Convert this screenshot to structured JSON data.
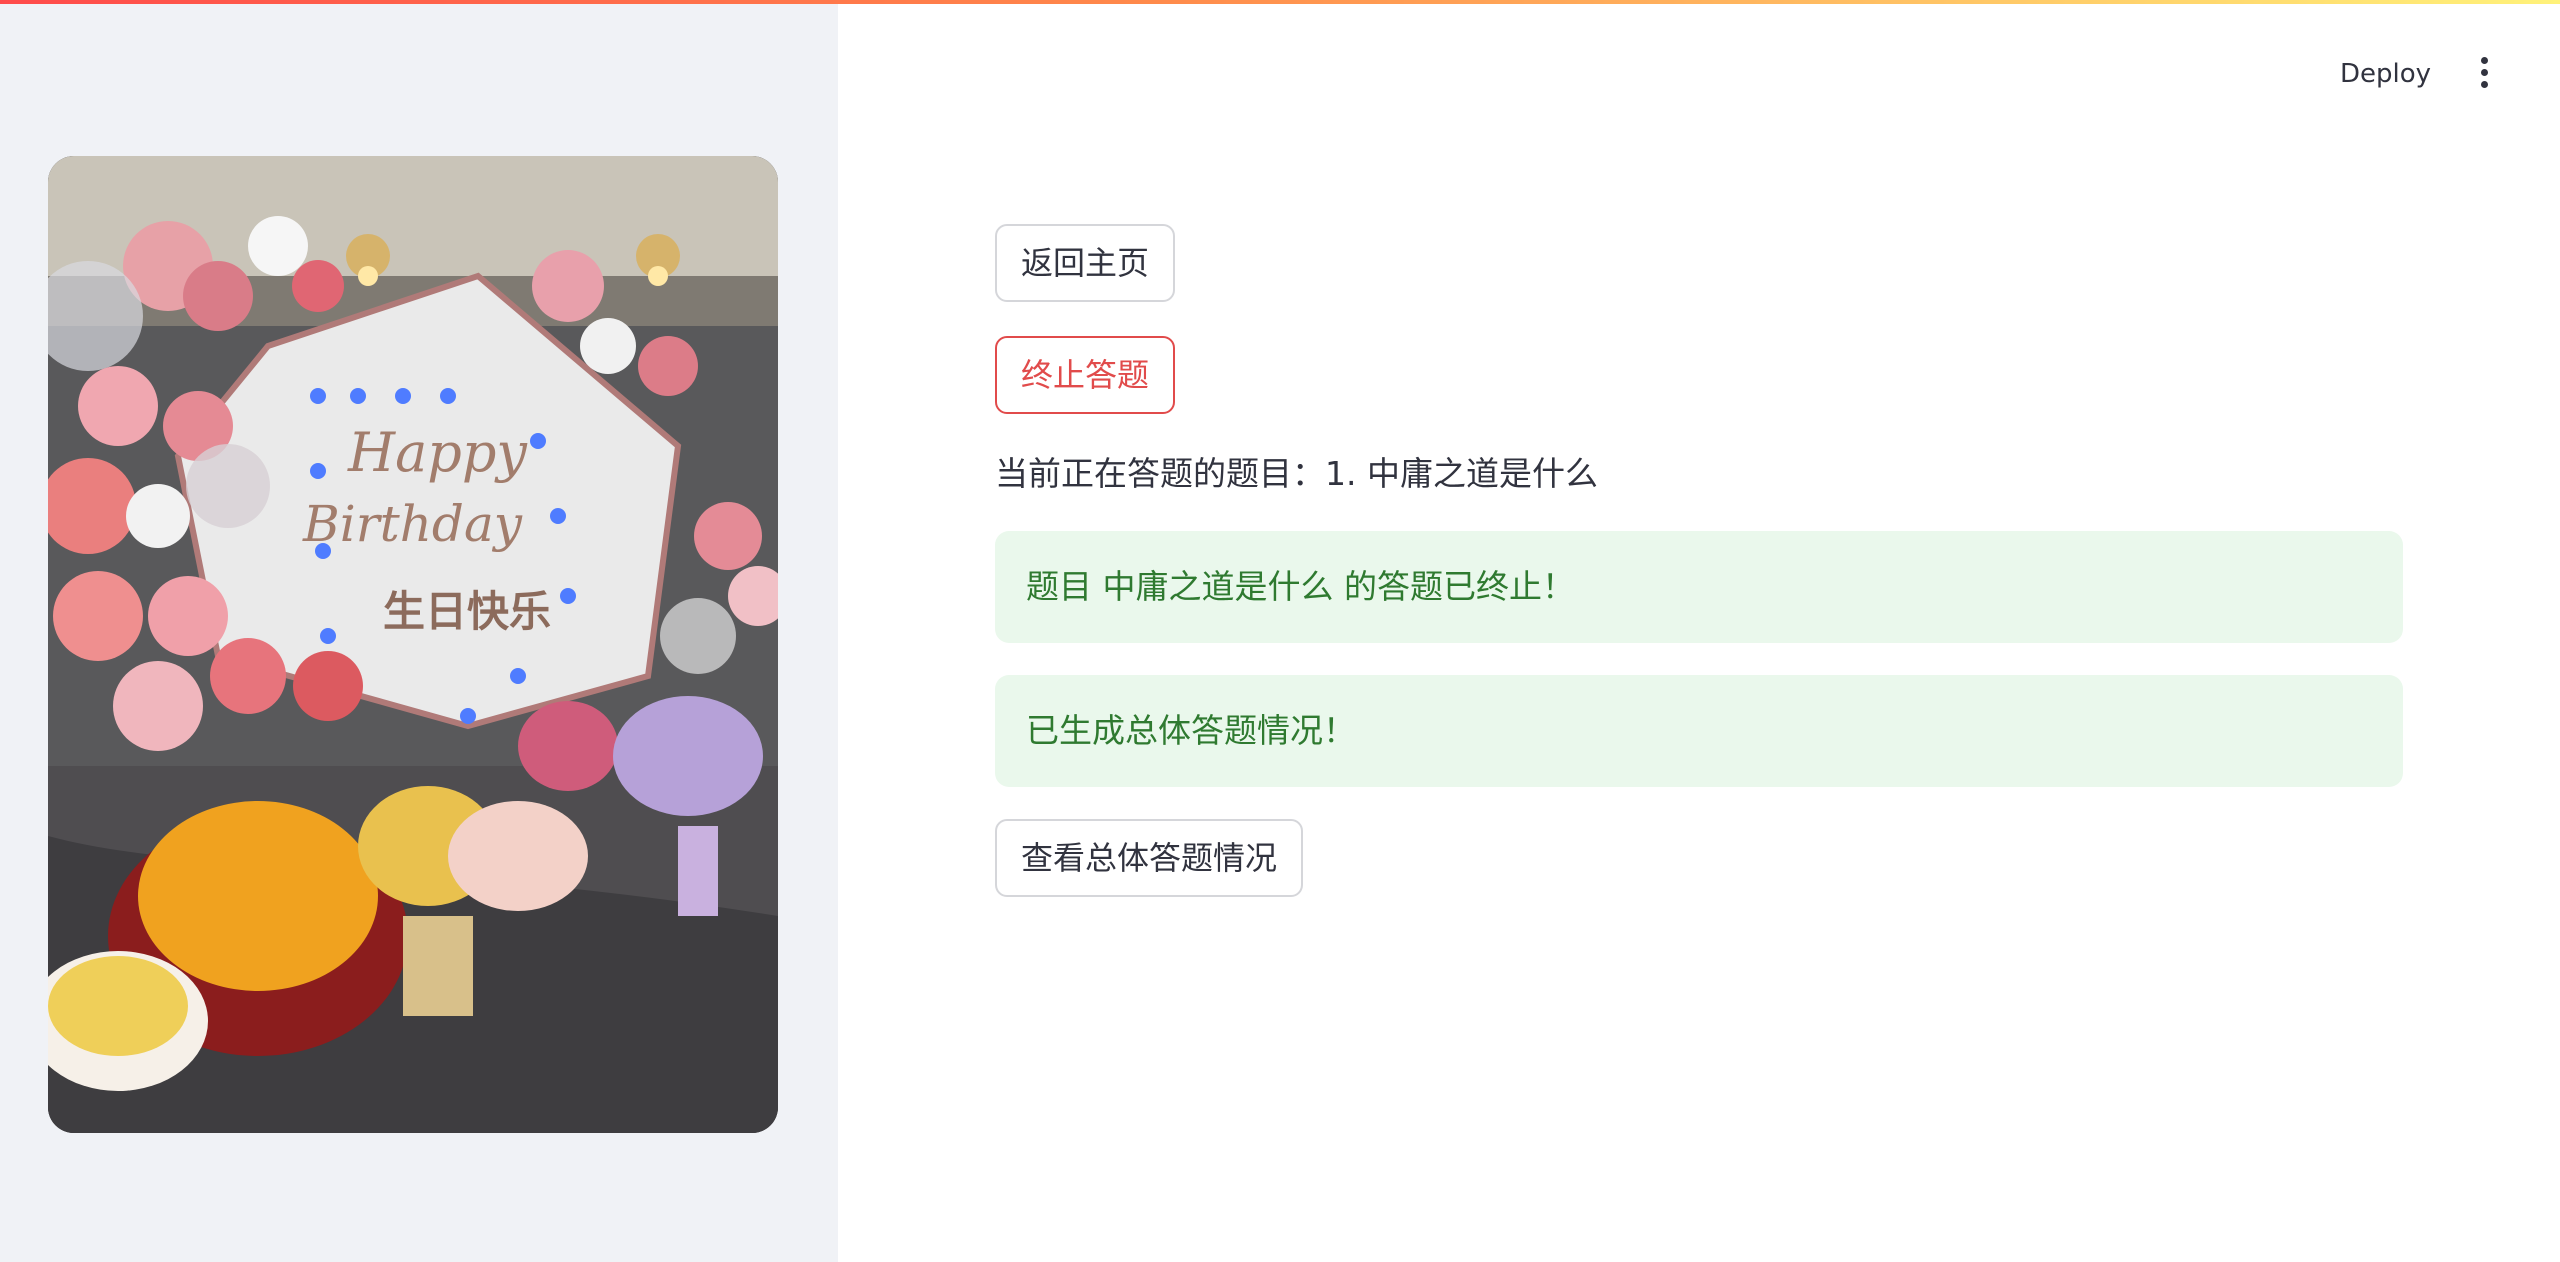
{
  "header": {
    "deploy_label": "Deploy",
    "menu_icon": "vertical-ellipsis-icon"
  },
  "sidebar": {
    "image": {
      "alt": "Happy Birthday 生日快乐",
      "text_line1": "Happy",
      "text_line2": "Birthday",
      "text_line3": "生日快乐"
    }
  },
  "main": {
    "back_home_label": "返回主页",
    "stop_quiz_label": "终止答题",
    "current_question_text": "当前正在答题的题目：1. 中庸之道是什么",
    "alerts": [
      "题目 中庸之道是什么 的答题已终止！",
      "已生成总体答题情况！"
    ],
    "view_summary_label": "查看总体答题情况"
  },
  "colors": {
    "accent": "#ff4b4b",
    "success_bg": "#eaf8ec",
    "success_text": "#2f7a30",
    "sidebar_bg": "#f0f2f6"
  }
}
